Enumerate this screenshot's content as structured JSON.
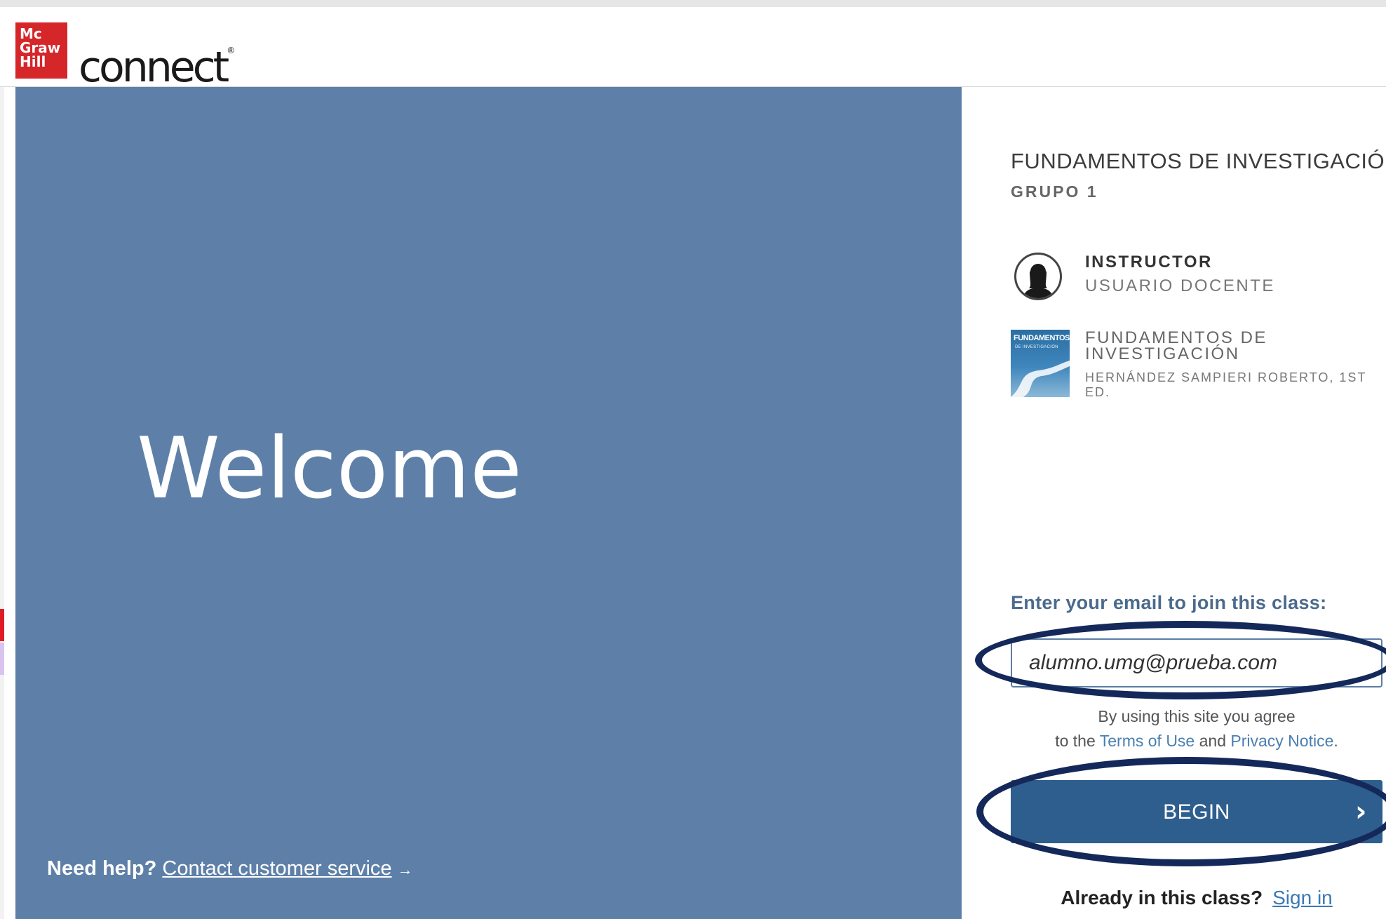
{
  "brand": {
    "logo_lines": [
      "Mc",
      "Graw",
      "Hill"
    ],
    "name": "connect",
    "mark": "®"
  },
  "hero": {
    "welcome": "Welcome",
    "help_label": "Need help?",
    "help_link": "Contact customer service",
    "help_arrow": "→"
  },
  "course": {
    "title": "FUNDAMENTOS DE INVESTIGACIÓN",
    "group": "GRUPO 1",
    "instructor_label": "INSTRUCTOR",
    "instructor_name": "USUARIO DOCENTE",
    "book_title": "FUNDAMENTOS DE INVESTIGACIÓN",
    "book_author": "HERNÁNDEZ SAMPIERI ROBERTO, 1ST ED.",
    "cover_title": "FUNDAMENTOS",
    "cover_subtitle": "DE INVESTIGACIÓN"
  },
  "join": {
    "email_label": "Enter your email to join this class:",
    "email_value": "alumno.umg@prueba.com",
    "agree_line1": "By using this site you agree",
    "agree_prefix": "to the",
    "terms_link": "Terms of Use",
    "agree_and": "and",
    "privacy_link": "Privacy Notice",
    "agree_end": ".",
    "begin_label": "BEGIN",
    "begin_icon": "chevron-right",
    "already_label": "Already in this class?",
    "signin_link": "Sign in"
  },
  "colors": {
    "hero": "#5e80a8",
    "button": "#2e5e8e",
    "annotation": "#14295a",
    "logo": "#d5262a"
  }
}
